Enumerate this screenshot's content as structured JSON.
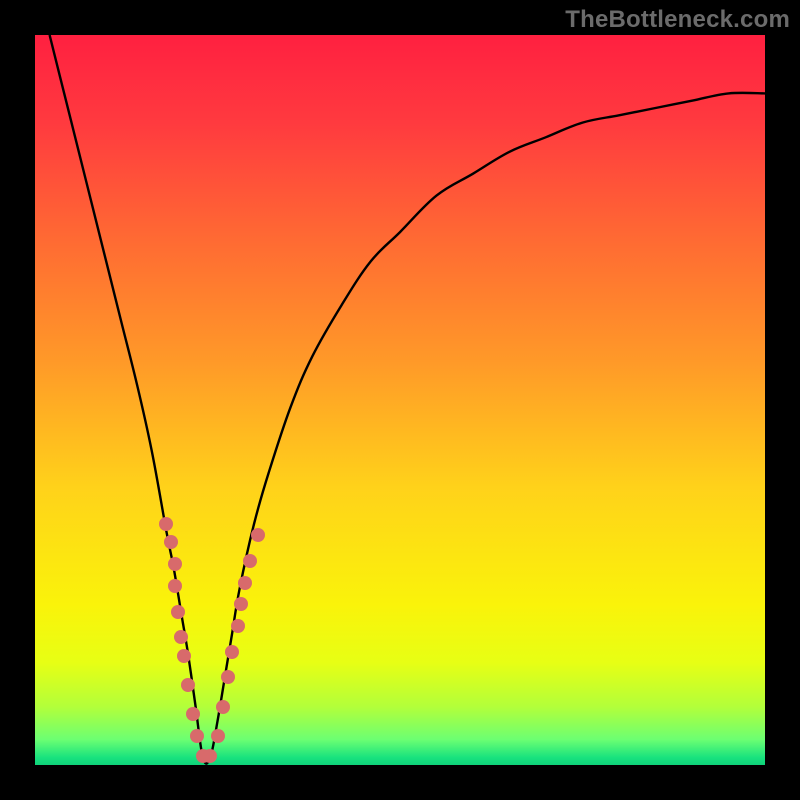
{
  "watermark": "TheBottleneck.com",
  "palette": {
    "gradient_stops": [
      {
        "pos": 0.0,
        "color": "#ff2040"
      },
      {
        "pos": 0.12,
        "color": "#ff3a3f"
      },
      {
        "pos": 0.28,
        "color": "#ff6a33"
      },
      {
        "pos": 0.45,
        "color": "#ff9a28"
      },
      {
        "pos": 0.62,
        "color": "#ffd21a"
      },
      {
        "pos": 0.78,
        "color": "#faf30a"
      },
      {
        "pos": 0.86,
        "color": "#e7ff14"
      },
      {
        "pos": 0.92,
        "color": "#b3ff3a"
      },
      {
        "pos": 0.965,
        "color": "#6cff72"
      },
      {
        "pos": 0.99,
        "color": "#18e27e"
      },
      {
        "pos": 1.0,
        "color": "#0fd27a"
      }
    ],
    "curve_color": "#000000",
    "marker_color": "#d86a6b",
    "frame_color": "#000000"
  },
  "chart_data": {
    "type": "line",
    "title": "",
    "xlabel": "",
    "ylabel": "",
    "xlim": [
      0,
      100
    ],
    "ylim": [
      0,
      100
    ],
    "x_optimum": 23,
    "series": [
      {
        "name": "bottleneck-curve",
        "x": [
          2,
          4,
          6,
          8,
          10,
          12,
          14,
          16,
          18,
          19,
          20,
          21,
          22,
          23,
          24,
          25,
          26,
          27,
          28,
          30,
          32,
          35,
          38,
          42,
          46,
          50,
          55,
          60,
          65,
          70,
          75,
          80,
          85,
          90,
          95,
          100
        ],
        "y": [
          100,
          92,
          84,
          76,
          68,
          60,
          52,
          43,
          32,
          27,
          21,
          15,
          8,
          1,
          1,
          6,
          12,
          18,
          24,
          33,
          40,
          49,
          56,
          63,
          69,
          73,
          78,
          81,
          84,
          86,
          88,
          89,
          90,
          91,
          92,
          92
        ]
      }
    ],
    "markers": {
      "name": "highlighted-points",
      "color": "#d86a6b",
      "points": [
        {
          "x": 18.0,
          "y": 33.0
        },
        {
          "x": 18.6,
          "y": 30.5
        },
        {
          "x": 19.2,
          "y": 27.5
        },
        {
          "x": 19.2,
          "y": 24.5
        },
        {
          "x": 19.6,
          "y": 21.0
        },
        {
          "x": 20.0,
          "y": 17.5
        },
        {
          "x": 20.4,
          "y": 15.0
        },
        {
          "x": 21.0,
          "y": 11.0
        },
        {
          "x": 21.6,
          "y": 7.0
        },
        {
          "x": 22.2,
          "y": 4.0
        },
        {
          "x": 23.0,
          "y": 1.2
        },
        {
          "x": 24.0,
          "y": 1.2
        },
        {
          "x": 25.0,
          "y": 4.0
        },
        {
          "x": 25.8,
          "y": 8.0
        },
        {
          "x": 26.4,
          "y": 12.0
        },
        {
          "x": 27.0,
          "y": 15.5
        },
        {
          "x": 27.8,
          "y": 19.0
        },
        {
          "x": 28.2,
          "y": 22.0
        },
        {
          "x": 28.8,
          "y": 25.0
        },
        {
          "x": 29.4,
          "y": 28.0
        },
        {
          "x": 30.5,
          "y": 31.5
        }
      ]
    }
  }
}
